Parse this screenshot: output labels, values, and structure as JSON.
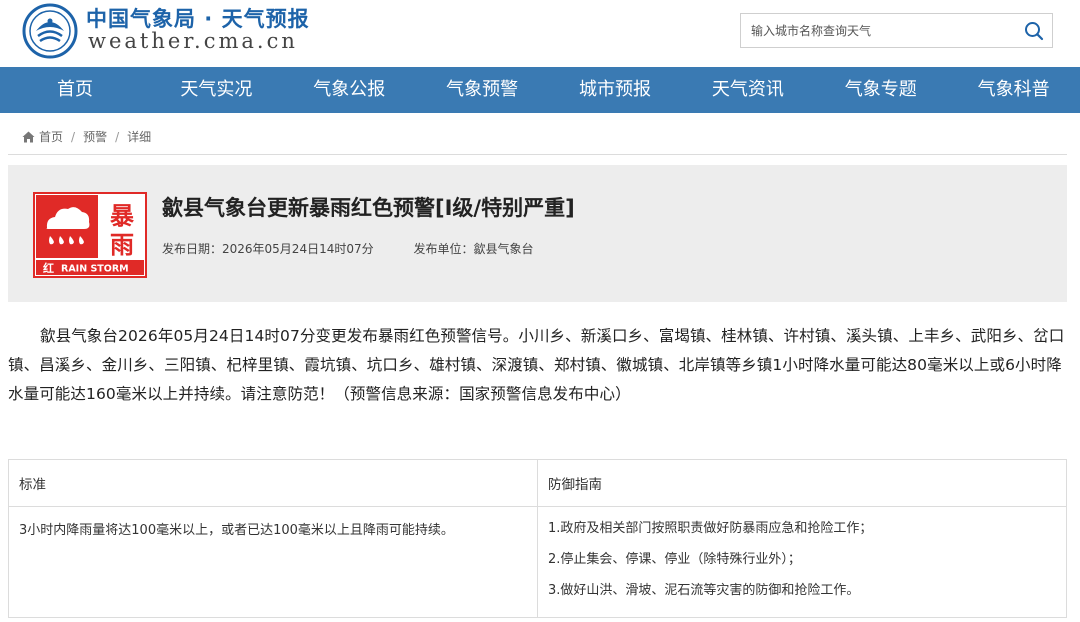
{
  "header": {
    "logo_cn": "中国气象局 · 天气预报",
    "logo_en": "weather.cma.cn",
    "search_placeholder": "输入城市名称查询天气"
  },
  "nav": {
    "items": [
      "首页",
      "天气实况",
      "气象公报",
      "气象预警",
      "城市预报",
      "天气资讯",
      "气象专题",
      "气象科普"
    ]
  },
  "breadcrumb": {
    "items": [
      "首页",
      "预警",
      "详细"
    ],
    "separator": "/"
  },
  "alert": {
    "icon": {
      "char_top": "暴",
      "char_bottom": "雨",
      "level_char": "红",
      "label_en": "RAIN STORM",
      "color": "#e02a27"
    },
    "title": "歙县气象台更新暴雨红色预警[I级/特别严重]",
    "publish_date": "发布日期：2026年05月24日14时07分",
    "publisher": "发布单位：歙县气象台"
  },
  "content": "歙县气象台2026年05月24日14时07分变更发布暴雨红色预警信号。小川乡、新溪口乡、富堨镇、桂林镇、许村镇、溪头镇、上丰乡、武阳乡、岔口镇、昌溪乡、金川乡、三阳镇、杞梓里镇、霞坑镇、坑口乡、雄村镇、深渡镇、郑村镇、徽城镇、北岸镇等乡镇1小时降水量可能达80毫米以上或6小时降水量可能达160毫米以上并持续。请注意防范！（预警信息来源：国家预警信息发布中心）",
  "table": {
    "headers": [
      "标准",
      "防御指南"
    ],
    "standard": "3小时内降雨量将达100毫米以上，或者已达100毫米以上且降雨可能持续。",
    "guide": [
      "1.政府及相关部门按照职责做好防暴雨应急和抢险工作；",
      "2.停止集会、停课、停业（除特殊行业外）；",
      "3.做好山洪、滑坡、泥石流等灾害的防御和抢险工作。"
    ]
  },
  "colors": {
    "nav_bg": "#3a7ab3",
    "brand_blue": "#1d63a9",
    "alert_red": "#e02a27",
    "card_bg": "#ededed"
  }
}
